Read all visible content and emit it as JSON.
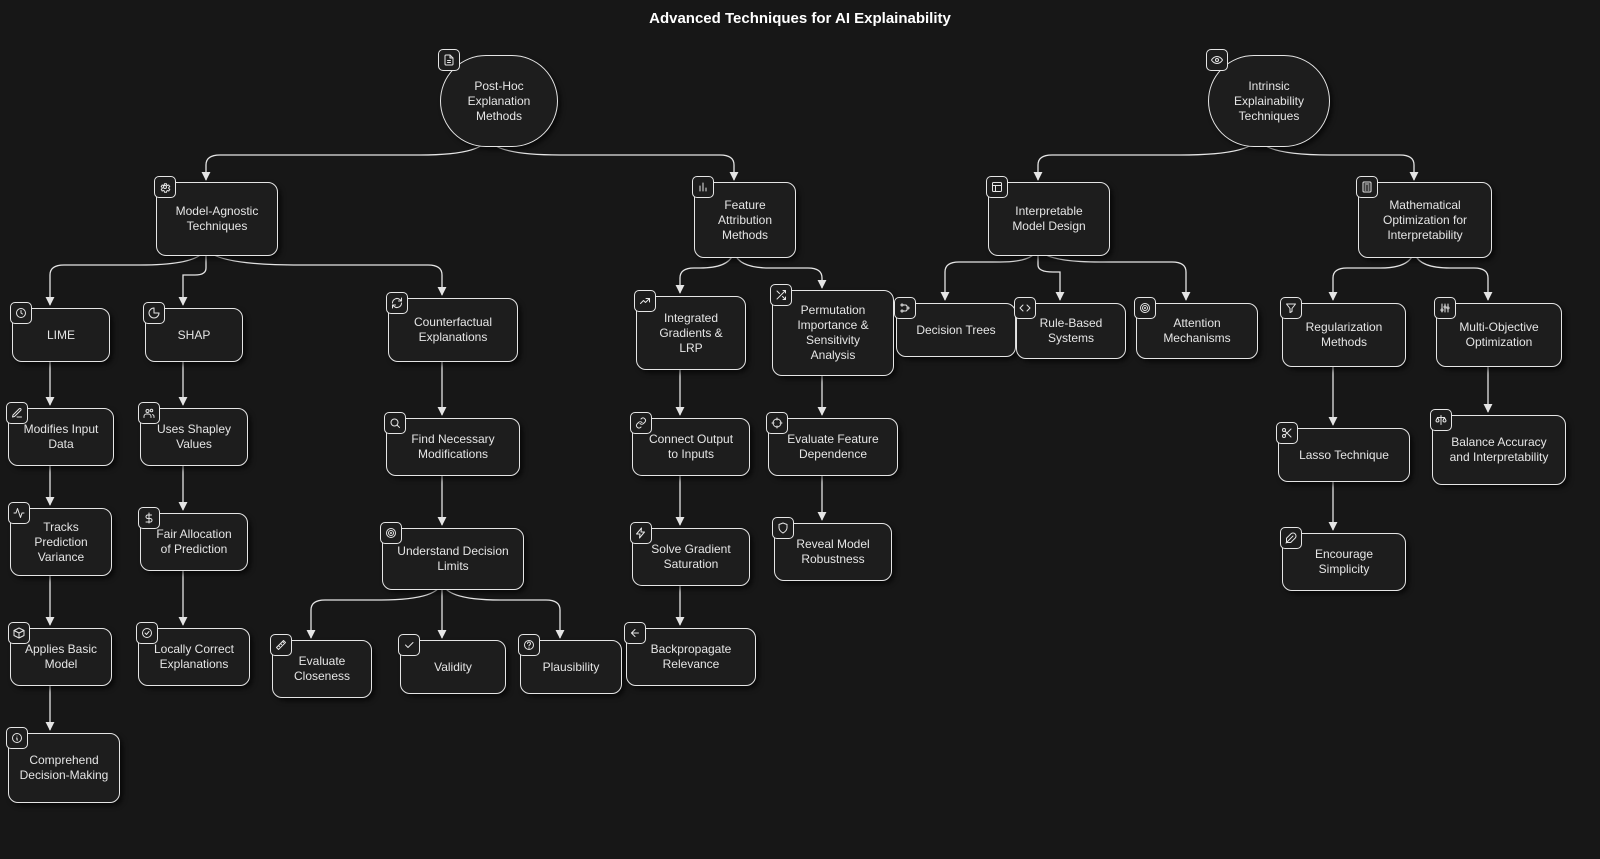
{
  "title": "Advanced Techniques for AI Explainability",
  "nodes": {
    "n1": {
      "label": "Post-Hoc Explanation Methods"
    },
    "n2": {
      "label": "Intrinsic Explainability Techniques"
    },
    "n3": {
      "label": "Model-Agnostic Techniques"
    },
    "n4": {
      "label": "Feature Attribution Methods"
    },
    "n5": {
      "label": "Interpretable Model Design"
    },
    "n6": {
      "label": "Mathematical Optimization for Interpretability"
    },
    "n7": {
      "label": "LIME"
    },
    "n8": {
      "label": "SHAP"
    },
    "n9": {
      "label": "Counterfactual Explanations"
    },
    "n10": {
      "label": "Integrated Gradients & LRP"
    },
    "n11": {
      "label": "Permutation Importance & Sensitivity Analysis"
    },
    "n12": {
      "label": "Decision Trees"
    },
    "n13": {
      "label": "Rule-Based Systems"
    },
    "n14": {
      "label": "Attention Mechanisms"
    },
    "n15": {
      "label": "Regularization Methods"
    },
    "n16": {
      "label": "Multi-Objective Optimization"
    },
    "n17": {
      "label": "Modifies Input Data"
    },
    "n18": {
      "label": "Uses Shapley Values"
    },
    "n19": {
      "label": "Find Necessary Modifications"
    },
    "n20": {
      "label": "Connect Output to Inputs"
    },
    "n21": {
      "label": "Evaluate Feature Dependence"
    },
    "n22": {
      "label": "Lasso Technique"
    },
    "n23": {
      "label": "Balance Accuracy and Interpretability"
    },
    "n24": {
      "label": "Tracks Prediction Variance"
    },
    "n25": {
      "label": "Fair Allocation of Prediction"
    },
    "n26": {
      "label": "Understand Decision Limits"
    },
    "n27": {
      "label": "Solve Gradient Saturation"
    },
    "n28": {
      "label": "Reveal Model Robustness"
    },
    "n29": {
      "label": "Encourage Simplicity"
    },
    "n30": {
      "label": "Applies Basic Model"
    },
    "n31": {
      "label": "Locally Correct Explanations"
    },
    "n32": {
      "label": "Evaluate Closeness"
    },
    "n33": {
      "label": "Validity"
    },
    "n34": {
      "label": "Plausibility"
    },
    "n35": {
      "label": "Backpropagate Relevance"
    },
    "n36": {
      "label": "Comprehend Decision-Making"
    }
  }
}
